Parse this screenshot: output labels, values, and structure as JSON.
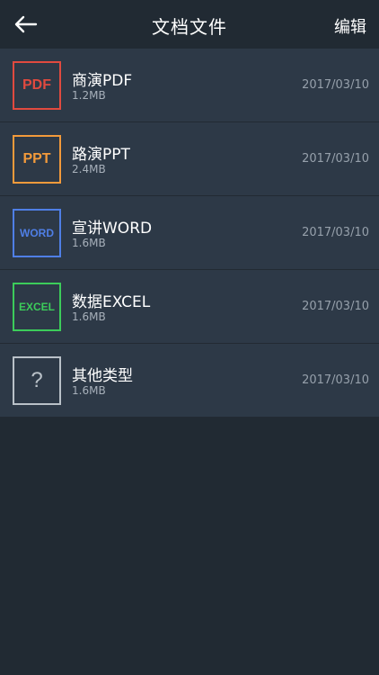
{
  "header": {
    "title": "文档文件",
    "edit_label": "编辑"
  },
  "files": [
    {
      "icon_label": "PDF",
      "icon_color": "#e04a3f",
      "name": "商演PDF",
      "size": "1.2MB",
      "date": "2017/03/10"
    },
    {
      "icon_label": "PPT",
      "icon_color": "#f29a3b",
      "name": "路演PPT",
      "size": "2.4MB",
      "date": "2017/03/10"
    },
    {
      "icon_label": "WORD",
      "icon_color": "#4f7fe6",
      "name": "宣讲WORD",
      "size": "1.6MB",
      "date": "2017/03/10"
    },
    {
      "icon_label": "EXCEL",
      "icon_color": "#3ccc5a",
      "name": "数据EXCEL",
      "size": "1.6MB",
      "date": "2017/03/10"
    },
    {
      "icon_label": "?",
      "icon_color": "#b9c1c8",
      "name": "其他类型",
      "size": "1.6MB",
      "date": "2017/03/10"
    }
  ]
}
